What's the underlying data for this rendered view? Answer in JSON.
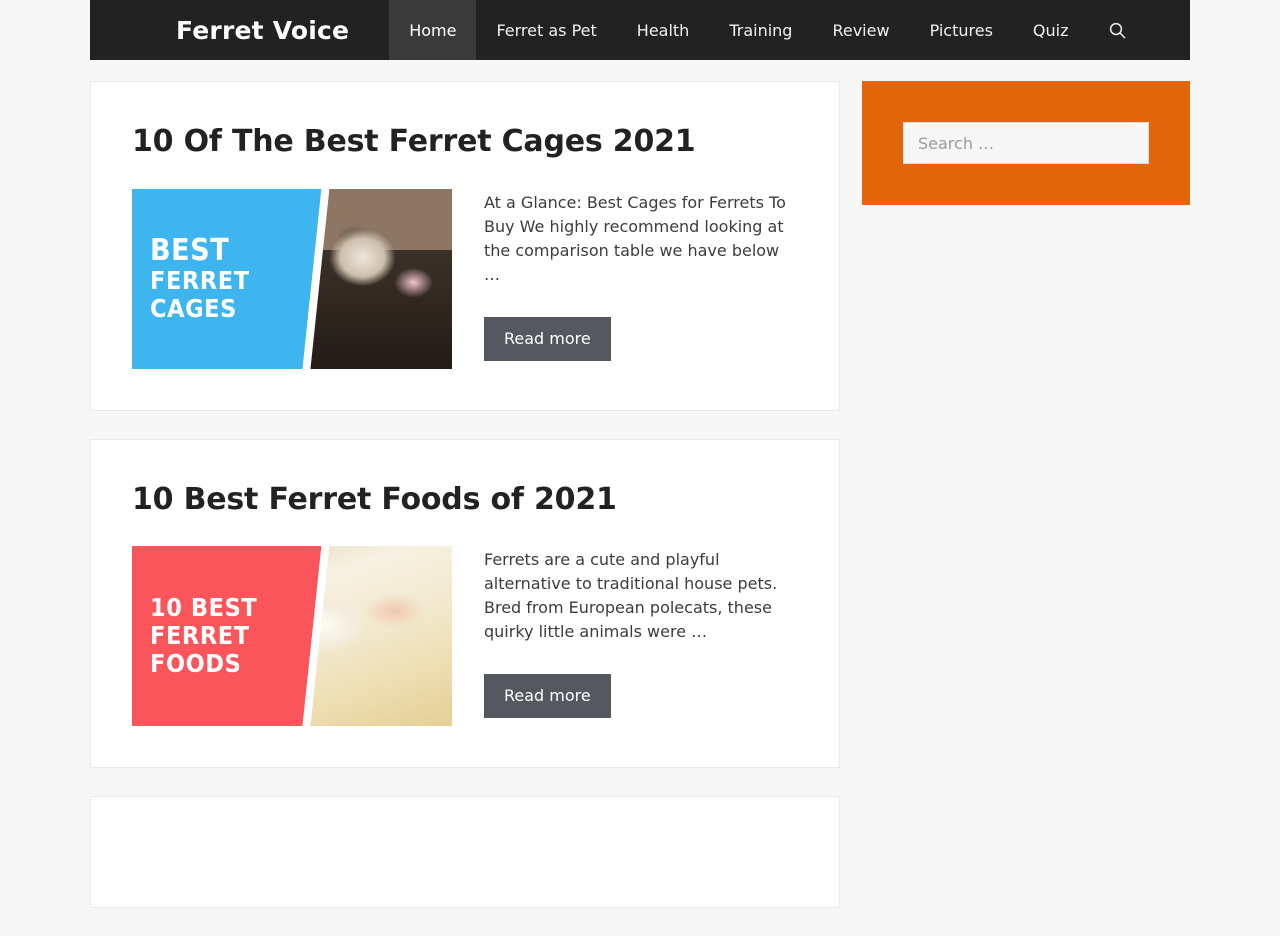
{
  "site": {
    "brand": "Ferret Voice"
  },
  "nav": {
    "items": [
      {
        "label": "Home",
        "active": true
      },
      {
        "label": "Ferret as Pet",
        "active": false
      },
      {
        "label": "Health",
        "active": false
      },
      {
        "label": "Training",
        "active": false
      },
      {
        "label": "Review",
        "active": false
      },
      {
        "label": "Pictures",
        "active": false
      },
      {
        "label": "Quiz",
        "active": false
      }
    ],
    "search_icon": "search-icon"
  },
  "articles": [
    {
      "title": "10 Of The Best Ferret Cages 2021",
      "excerpt": "At a Glance: Best Cages for Ferrets To Buy We highly recommend looking at the comparison table we have below …",
      "read_more_label": "Read more",
      "thumbnail": {
        "panel_color": "#3FB5F0",
        "line1": "Best",
        "line2": "Ferret",
        "line3": "Cages",
        "alt": "Sable ferret in a cage"
      }
    },
    {
      "title": "10 Best Ferret Foods of 2021",
      "excerpt": "Ferrets are a cute and playful alternative to traditional house pets. Bred from European polecats, these quirky little animals were …",
      "read_more_label": "Read more",
      "thumbnail": {
        "panel_color": "#F9555A",
        "line1": "10 Best",
        "line2": "Ferret",
        "line3": "Foods",
        "alt": "Albino ferret being petted"
      }
    }
  ],
  "sidebar": {
    "search_widget": {
      "placeholder": "Search …",
      "value": "",
      "background": "#E2650A"
    }
  }
}
